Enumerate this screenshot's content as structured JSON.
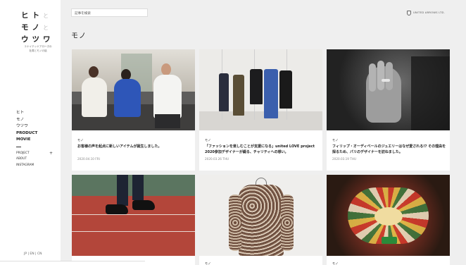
{
  "logo": {
    "row1": [
      "ヒ",
      "ト",
      "と"
    ],
    "row2": [
      "モ",
      "ノ",
      "と"
    ],
    "row3": [
      "ウ",
      "ツ",
      "ワ"
    ]
  },
  "tagline": [
    "ユナイテッドアローズの",
    "社員とモノの話"
  ],
  "nav": {
    "items": [
      "ヒト",
      "モノ",
      "ウツワ",
      "PRODUCT",
      "MOVIE"
    ],
    "sub_items": [
      "PROJECT",
      "ABOUT",
      "INSTAGRAM"
    ],
    "plus": "+"
  },
  "lang": "JP | EN | CN",
  "search": {
    "placeholder": "記事を検索"
  },
  "brand": {
    "name": "UNITED ARROWS LTD."
  },
  "page_title": "モノ",
  "cards": [
    {
      "category": "モノ",
      "title": "お客様の声を起点に新しいアイテムが誕生しました。",
      "date": "2020.04.10 FRI"
    },
    {
      "category": "モノ",
      "title": "「ファッションを楽しむことが支援になる」united LOVE project 2020参加デザイナーが綴る、チャリティへの想い。",
      "date": "2020.03.26 THU"
    },
    {
      "category": "モノ",
      "title": "フィリップ・オーディベールのジュエリーはなぜ愛される!? その理由を探るため、パリのデザイナーを訪ねました。",
      "date": "2020.03.19 THU"
    },
    {
      "category": "",
      "title": "",
      "date": ""
    },
    {
      "category": "モノ",
      "title": "",
      "date": ""
    },
    {
      "category": "モノ",
      "title": "",
      "date": ""
    }
  ],
  "colors": {
    "main_bg": "#efefef",
    "sidebar_bg": "#ffffff",
    "text": "#222222",
    "muted": "#888888"
  }
}
